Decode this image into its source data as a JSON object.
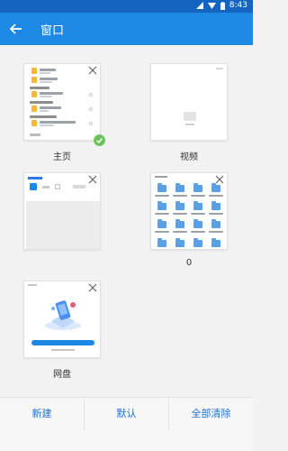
{
  "status": {
    "time": "8:43"
  },
  "header": {
    "title": "窗口",
    "back_icon": "arrow-left-icon"
  },
  "windows": [
    {
      "label": "主页",
      "thumbnail": "file-list",
      "selected": true,
      "has_close": true
    },
    {
      "label": "视频",
      "thumbnail": "video-empty",
      "selected": false,
      "has_close": false
    },
    {
      "label": "",
      "thumbnail": "webpage",
      "selected": false,
      "has_close": true
    },
    {
      "label": "0",
      "thumbnail": "folder-grid",
      "selected": false,
      "has_close": true
    },
    {
      "label": "网盘",
      "thumbnail": "cloud-illustration",
      "selected": false,
      "has_close": true
    }
  ],
  "bottom": {
    "new_label": "新建",
    "default_label": "默认",
    "clear_all_label": "全部清除"
  },
  "colors": {
    "appbar": "#1e88e5",
    "statusbar": "#1565c0",
    "accent_text": "#1e6fd9",
    "check": "#6ac259",
    "folder": "#5aa0e6"
  }
}
